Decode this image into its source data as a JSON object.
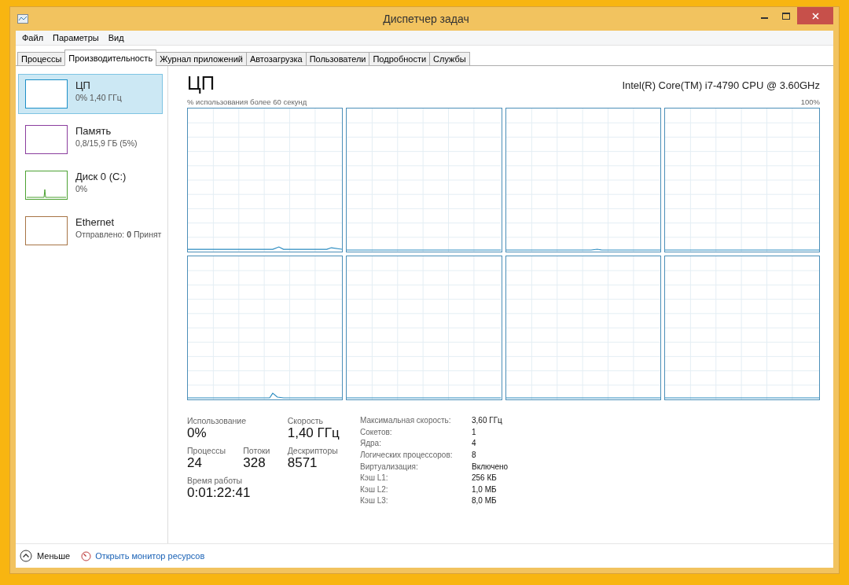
{
  "window": {
    "title": "Диспетчер задач"
  },
  "menu": [
    "Файл",
    "Параметры",
    "Вид"
  ],
  "tabs": [
    {
      "label": "Процессы",
      "selected": false
    },
    {
      "label": "Производительность",
      "selected": true
    },
    {
      "label": "Журнал приложений",
      "selected": false
    },
    {
      "label": "Автозагрузка",
      "selected": false
    },
    {
      "label": "Пользователи",
      "selected": false
    },
    {
      "label": "Подробности",
      "selected": false
    },
    {
      "label": "Службы",
      "selected": false
    }
  ],
  "sidebar": {
    "items": [
      {
        "title": "ЦП",
        "subtitle": "0%  1,40 ГГц",
        "selected": true,
        "color": "#1d8fc7"
      },
      {
        "title": "Память",
        "subtitle": "0,8/15,9 ГБ (5%)",
        "selected": false,
        "color": "#8b3e9e"
      },
      {
        "title": "Диск 0 (C:)",
        "subtitle": "0%",
        "selected": false,
        "color": "#4da233"
      },
      {
        "title": "Ethernet",
        "subtitle": "Отправлено: **0** Принят",
        "selected": false,
        "color": "#a77445"
      }
    ]
  },
  "main": {
    "title": "ЦП",
    "processor": "Intel(R) Core(TM) i7-4790 CPU @ 3.60GHz",
    "graph_caption": "% использования более 60 секунд",
    "graph_max": "100%"
  },
  "stats": [
    {
      "label": "Использование",
      "value": "0%"
    },
    {
      "label": "Скорость",
      "value": "1,40 ГГц"
    },
    {
      "label": "Процессы",
      "value": "24"
    },
    {
      "label": "Потоки",
      "value": "328"
    },
    {
      "label": "Дескрипторы",
      "value": "8571"
    },
    {
      "label": "Время работы",
      "value": "0:01:22:41"
    }
  ],
  "details": [
    {
      "label": "Максимальная скорость:",
      "value": "3,60 ГГц"
    },
    {
      "label": "Сокетов:",
      "value": "1"
    },
    {
      "label": "Ядра:",
      "value": "4"
    },
    {
      "label": "Логических процессоров:",
      "value": "8"
    },
    {
      "label": "Виртуализация:",
      "value": "Включено"
    },
    {
      "label": "Кэш L1:",
      "value": "256 КБ"
    },
    {
      "label": "Кэш L2:",
      "value": "1,0 МБ"
    },
    {
      "label": "Кэш L3:",
      "value": "8,0 МБ"
    }
  ],
  "footer": {
    "less": "Меньше",
    "monitor_link": "Открыть монитор ресурсов"
  }
}
